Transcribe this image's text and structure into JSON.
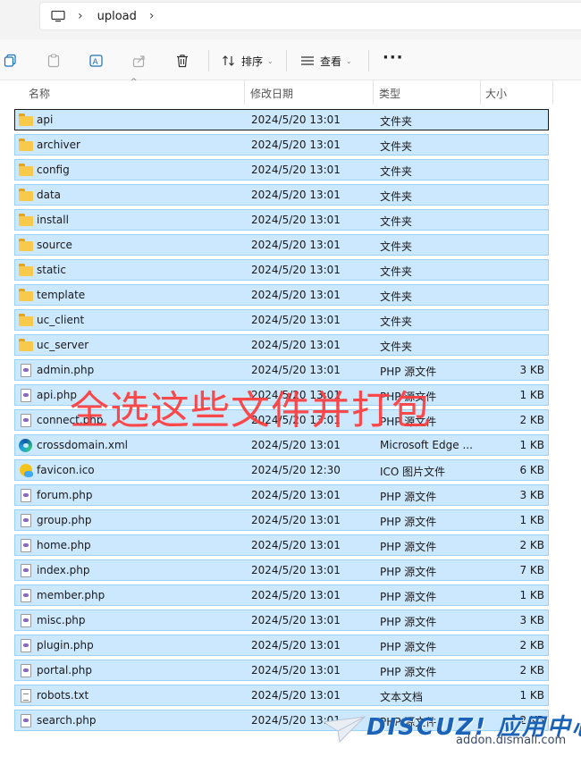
{
  "address": {
    "crumb": "upload",
    "sep": "›"
  },
  "toolbar": {
    "sort_label": "排序",
    "view_label": "查看",
    "more_label": "···"
  },
  "columns": {
    "name": "名称",
    "date": "修改日期",
    "type": "类型",
    "size": "大小"
  },
  "rows": [
    {
      "name": "api",
      "date": "2024/5/20 13:01",
      "type": "文件夹",
      "size": "",
      "icon": "folder"
    },
    {
      "name": "archiver",
      "date": "2024/5/20 13:01",
      "type": "文件夹",
      "size": "",
      "icon": "folder"
    },
    {
      "name": "config",
      "date": "2024/5/20 13:01",
      "type": "文件夹",
      "size": "",
      "icon": "folder"
    },
    {
      "name": "data",
      "date": "2024/5/20 13:01",
      "type": "文件夹",
      "size": "",
      "icon": "folder"
    },
    {
      "name": "install",
      "date": "2024/5/20 13:01",
      "type": "文件夹",
      "size": "",
      "icon": "folder"
    },
    {
      "name": "source",
      "date": "2024/5/20 13:01",
      "type": "文件夹",
      "size": "",
      "icon": "folder"
    },
    {
      "name": "static",
      "date": "2024/5/20 13:01",
      "type": "文件夹",
      "size": "",
      "icon": "folder"
    },
    {
      "name": "template",
      "date": "2024/5/20 13:01",
      "type": "文件夹",
      "size": "",
      "icon": "folder"
    },
    {
      "name": "uc_client",
      "date": "2024/5/20 13:01",
      "type": "文件夹",
      "size": "",
      "icon": "folder"
    },
    {
      "name": "uc_server",
      "date": "2024/5/20 13:01",
      "type": "文件夹",
      "size": "",
      "icon": "folder"
    },
    {
      "name": "admin.php",
      "date": "2024/5/20 13:01",
      "type": "PHP 源文件",
      "size": "3 KB",
      "icon": "php"
    },
    {
      "name": "api.php",
      "date": "2024/5/20 13:01",
      "type": "PHP 源文件",
      "size": "1 KB",
      "icon": "php"
    },
    {
      "name": "connect.php",
      "date": "2024/5/20 13:01",
      "type": "PHP 源文件",
      "size": "2 KB",
      "icon": "php"
    },
    {
      "name": "crossdomain.xml",
      "date": "2024/5/20 13:01",
      "type": "Microsoft Edge ...",
      "size": "1 KB",
      "icon": "edge"
    },
    {
      "name": "favicon.ico",
      "date": "2024/5/20 12:30",
      "type": "ICO 图片文件",
      "size": "6 KB",
      "icon": "ico"
    },
    {
      "name": "forum.php",
      "date": "2024/5/20 13:01",
      "type": "PHP 源文件",
      "size": "3 KB",
      "icon": "php"
    },
    {
      "name": "group.php",
      "date": "2024/5/20 13:01",
      "type": "PHP 源文件",
      "size": "1 KB",
      "icon": "php"
    },
    {
      "name": "home.php",
      "date": "2024/5/20 13:01",
      "type": "PHP 源文件",
      "size": "2 KB",
      "icon": "php"
    },
    {
      "name": "index.php",
      "date": "2024/5/20 13:01",
      "type": "PHP 源文件",
      "size": "7 KB",
      "icon": "php"
    },
    {
      "name": "member.php",
      "date": "2024/5/20 13:01",
      "type": "PHP 源文件",
      "size": "1 KB",
      "icon": "php"
    },
    {
      "name": "misc.php",
      "date": "2024/5/20 13:01",
      "type": "PHP 源文件",
      "size": "3 KB",
      "icon": "php"
    },
    {
      "name": "plugin.php",
      "date": "2024/5/20 13:01",
      "type": "PHP 源文件",
      "size": "2 KB",
      "icon": "php"
    },
    {
      "name": "portal.php",
      "date": "2024/5/20 13:01",
      "type": "PHP 源文件",
      "size": "2 KB",
      "icon": "php"
    },
    {
      "name": "robots.txt",
      "date": "2024/5/20 13:01",
      "type": "文本文档",
      "size": "1 KB",
      "icon": "txt"
    },
    {
      "name": "search.php",
      "date": "2024/5/20 13:01",
      "type": "PHP 源文件",
      "size": "2 KB",
      "icon": "php"
    }
  ],
  "annotation": "全选这些文件并打包",
  "watermark": {
    "logo": "DISCUZ! 应用中心",
    "url": "addon.dismall.com"
  },
  "colors": {
    "selection": "#cce8ff",
    "selection_border": "#99d1ff",
    "annotation": "#ff3b3b"
  }
}
